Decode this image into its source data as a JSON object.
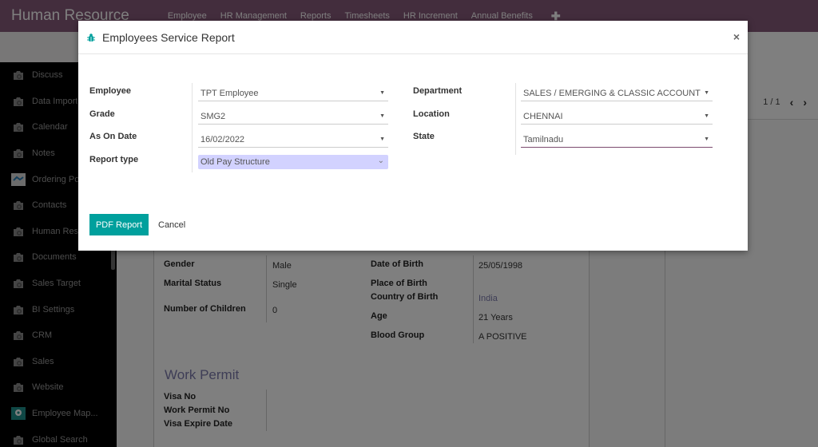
{
  "navbar": {
    "app_title": "Human Resource",
    "menu": [
      "Employee",
      "HR Management",
      "Reports",
      "Timesheets",
      "HR Increment",
      "Annual Benefits"
    ],
    "plus_icon": "plus-icon"
  },
  "sidebar": {
    "items": [
      {
        "label": "Discuss",
        "icon": "module-icon"
      },
      {
        "label": "Data Import",
        "icon": "module-icon"
      },
      {
        "label": "Calendar",
        "icon": "module-icon"
      },
      {
        "label": "Notes",
        "icon": "module-icon"
      },
      {
        "label": "Ordering Po",
        "icon": "handshake-icon"
      },
      {
        "label": "Contacts",
        "icon": "module-icon"
      },
      {
        "label": "Human Reso",
        "icon": "module-icon"
      },
      {
        "label": "Documents",
        "icon": "module-icon"
      },
      {
        "label": "Sales Target",
        "icon": "module-icon"
      },
      {
        "label": "BI Settings",
        "icon": "module-icon"
      },
      {
        "label": "CRM",
        "icon": "module-icon"
      },
      {
        "label": "Sales",
        "icon": "module-icon"
      },
      {
        "label": "Website",
        "icon": "module-icon"
      },
      {
        "label": "Employee Map...",
        "icon": "map-pin-icon"
      },
      {
        "label": "Global Search",
        "icon": "module-icon"
      }
    ]
  },
  "pager": {
    "value": "1 / 1"
  },
  "employee_form": {
    "left": [
      {
        "label": "Gender",
        "value": "Male"
      },
      {
        "label": "Marital Status",
        "value": "Single"
      },
      {
        "label": "Number of Children",
        "value": "0"
      }
    ],
    "right": [
      {
        "label": "Date of Birth",
        "value": "25/05/1998"
      },
      {
        "label": "Place of Birth",
        "value": ""
      },
      {
        "label": "Country of Birth",
        "value": "India"
      },
      {
        "label": "Age",
        "value": "21 Years"
      },
      {
        "label": "Blood Group",
        "value": "A POSITIVE"
      }
    ],
    "work_permit": {
      "title": "Work Permit",
      "fields": [
        "Visa No",
        "Work Permit No",
        "Visa Expire Date"
      ]
    }
  },
  "modal": {
    "title": "Employees Service Report",
    "close": "×",
    "fields_left": [
      {
        "label": "Employee",
        "value": "TPT Employee"
      },
      {
        "label": "Grade",
        "value": "SMG2"
      },
      {
        "label": "As On Date",
        "value": "16/02/2022"
      },
      {
        "label": "Report type",
        "value": "Old Pay Structure"
      }
    ],
    "fields_right": [
      {
        "label": "Department",
        "value": "SALES / EMERGING & CLASSIC ACCOUNT"
      },
      {
        "label": "Location",
        "value": "CHENNAI"
      },
      {
        "label": "State",
        "value": "Tamilnadu"
      }
    ],
    "buttons": {
      "primary": "PDF Report",
      "cancel": "Cancel"
    }
  },
  "colors": {
    "navbar": "#875a7b",
    "primary_button": "#00a09d",
    "link": "#7c7bad",
    "select_highlight": "#d2d2ff"
  }
}
